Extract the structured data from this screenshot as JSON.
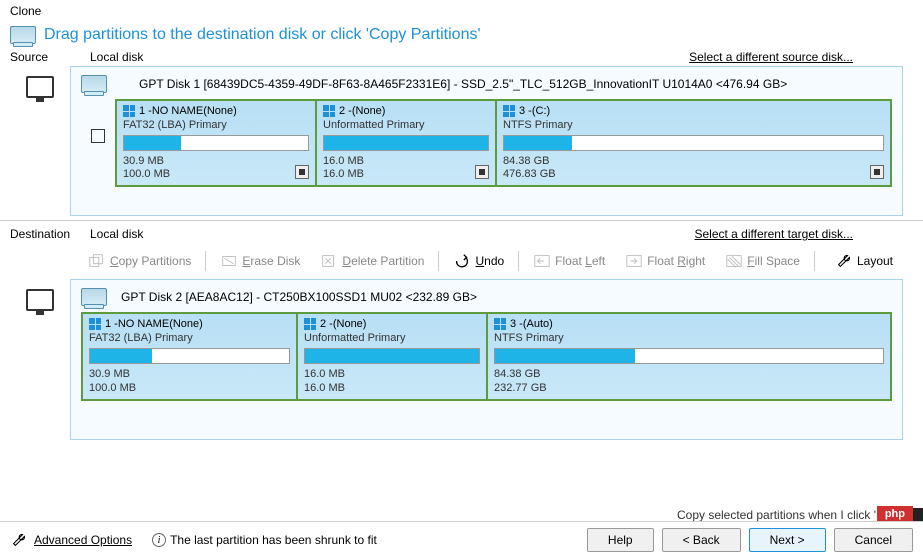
{
  "window": {
    "title": "Clone"
  },
  "instruction": "Drag partitions to the destination disk or click 'Copy Partitions'",
  "source": {
    "label": "Source",
    "type": "Local disk",
    "select_link": "Select a different source disk...",
    "disk_title": "GPT Disk 1 [68439DC5-4359-49DF-8F63-8A465F2331E6] - SSD_2.5\"_TLC_512GB_InnovationIT U1014A0  <476.94 GB>",
    "partitions": [
      {
        "num": "1 - ",
        "name": "NO NAME",
        "suffix": " (None)",
        "fs": "FAT32 (LBA) Primary",
        "used": "30.9 MB",
        "total": "100.0 MB",
        "fill": 31
      },
      {
        "num": "2 - ",
        "name": "",
        "suffix": " (None)",
        "fs": "Unformatted Primary",
        "used": "16.0 MB",
        "total": "16.0 MB",
        "fill": 100
      },
      {
        "num": "3 - ",
        "name": "",
        "suffix": " (C:)",
        "fs": "NTFS Primary",
        "used": "84.38 GB",
        "total": "476.83 GB",
        "fill": 18
      }
    ]
  },
  "destination": {
    "label": "Destination",
    "type": "Local disk",
    "select_link": "Select a different target disk...",
    "disk_title": "GPT Disk 2 [AEA8AC12] - CT250BX100SSD1 MU02  <232.89 GB>",
    "partitions": [
      {
        "num": "1 - ",
        "name": "NO NAME",
        "suffix": " (None)",
        "fs": "FAT32 (LBA) Primary",
        "used": "30.9 MB",
        "total": "100.0 MB",
        "fill": 31
      },
      {
        "num": "2 - ",
        "name": "",
        "suffix": " (None)",
        "fs": "Unformatted Primary",
        "used": "16.0 MB",
        "total": "16.0 MB",
        "fill": 100
      },
      {
        "num": "3 - ",
        "name": "",
        "suffix": " (Auto)",
        "fs": "NTFS Primary",
        "used": "84.38 GB",
        "total": "232.77 GB",
        "fill": 36
      }
    ]
  },
  "toolbar": {
    "copy_partitions": "Copy Partitions",
    "erase_disk": "Erase Disk",
    "delete_partition": "Delete Partition",
    "undo": "Undo",
    "float_left": "Float Left",
    "float_right": "Float Right",
    "fill_space": "Fill Space",
    "layout": "Layout"
  },
  "footer": {
    "advanced_options": "Advanced Options",
    "status": "The last partition has been shrunk to fit",
    "copy_note": "Copy selected partitions when I click 'Next'",
    "help": "Help",
    "back": "< Back",
    "next": "Next >",
    "cancel": "Cancel"
  },
  "badge": "php"
}
